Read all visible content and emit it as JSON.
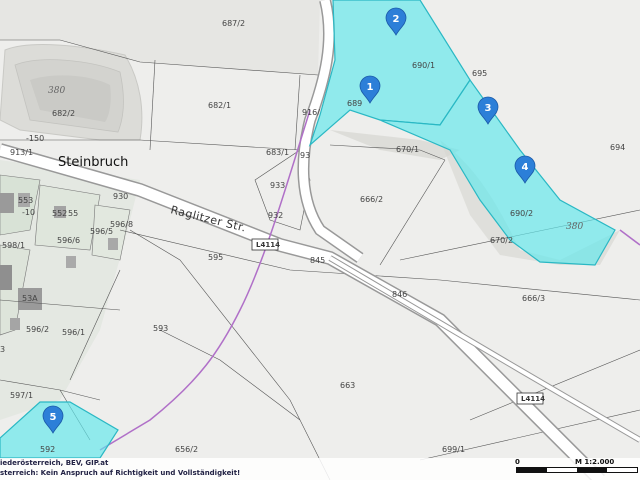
{
  "map": {
    "place_name": "Steinbruch",
    "street_name": "Raglitzer Str.",
    "road_numbers": [
      "L4114",
      "L4114"
    ],
    "contour_labels": [
      "380",
      "380"
    ],
    "parcels": [
      "687/2",
      "682/2",
      "682/1",
      "689",
      "690/1",
      "695",
      "694",
      "670/1",
      "683/1",
      "93",
      "930",
      "933",
      "932",
      "666/2",
      "690/2",
      "670/2",
      "916/",
      "913/1",
      "-150",
      "553",
      "552",
      "55",
      "-10",
      "596/8",
      "596/5",
      "596/6",
      "598/1",
      "595",
      "845",
      "846",
      "666/3",
      "53A",
      "596/2",
      "596/1",
      "593",
      "663",
      "597/1",
      "592",
      "656/2",
      "699/1",
      "3"
    ],
    "markers": [
      "1",
      "2",
      "3",
      "4",
      "5"
    ],
    "colors": {
      "background": "#eeeeec",
      "highlight_fill": "#5ee8ec",
      "highlight_stroke": "#2ab8c4",
      "marker_fill": "#2c7fd8",
      "boundary_line": "#b070c8",
      "road_fill": "#ffffff"
    }
  },
  "footer": {
    "attribution_line1": "iederösterreich, BEV, GIP.at",
    "attribution_line2": "sterreich: Kein Anspruch auf Richtigkeit und Vollständigkeit!",
    "scale_zero": "0",
    "scale_label": "M 1:2.000"
  }
}
